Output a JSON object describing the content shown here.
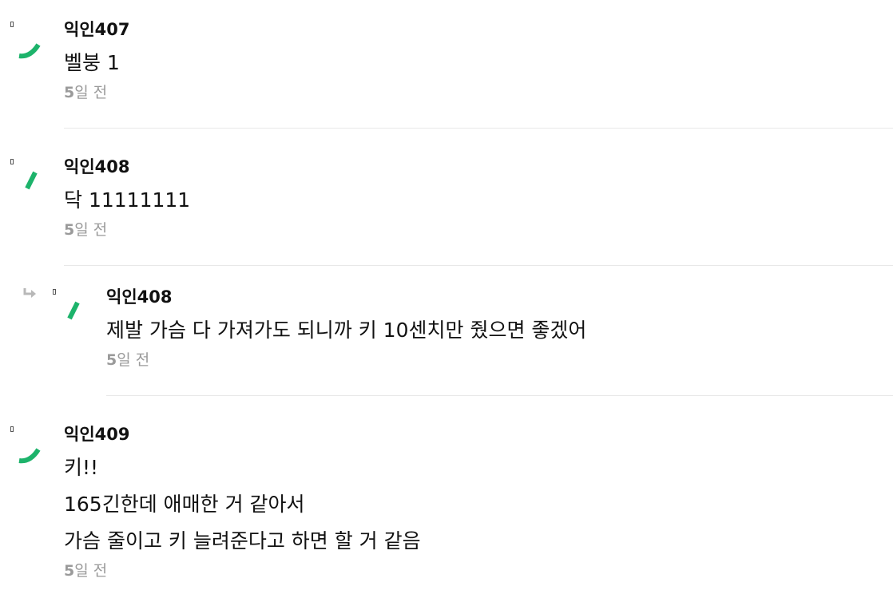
{
  "comments": [
    {
      "author": "익인407",
      "lines": [
        "벨붕 1"
      ],
      "time_num": "5",
      "time_unit": "일 전",
      "avatar_color": "#1db36b",
      "avatar_shape": "arc-avatar-icon",
      "is_reply": false
    },
    {
      "author": "익인408",
      "lines": [
        "닥 11111111"
      ],
      "time_num": "5",
      "time_unit": "일 전",
      "avatar_color": "#1db36b",
      "avatar_shape": "slash-avatar-icon",
      "is_reply": false
    },
    {
      "author": "익인408",
      "lines": [
        "제발 가슴 다 가져가도 되니까 키 10센치만 줬으면 좋겠어"
      ],
      "time_num": "5",
      "time_unit": "일 전",
      "avatar_color": "#1db36b",
      "avatar_shape": "slash-avatar-icon",
      "is_reply": true,
      "reply_icon": "reply-arrow-icon"
    },
    {
      "author": "익인409",
      "lines": [
        "키!!",
        "165긴한데 애매한 거 같아서",
        "가슴 줄이고 키 늘려준다고 하면 할 거 같음"
      ],
      "time_num": "5",
      "time_unit": "일 전",
      "avatar_color": "#1db36b",
      "avatar_shape": "arc-avatar-icon",
      "is_reply": false
    }
  ]
}
